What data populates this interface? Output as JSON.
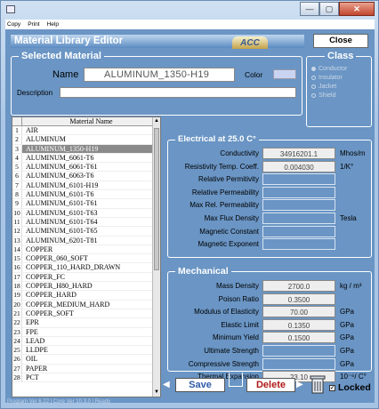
{
  "menu": [
    "Copy",
    "Print",
    "Help"
  ],
  "window_buttons": {
    "minimize": "—",
    "maximize": "▢",
    "close": "✕"
  },
  "header": {
    "title": "Material Library Editor",
    "logo": "ACC",
    "close_label": "Close"
  },
  "selected": {
    "title": "Selected Material",
    "name_label": "Name",
    "name_value": "ALUMINUM_1350-H19",
    "color_label": "Color",
    "color_value": "#c9d4f2",
    "description_label": "Description",
    "description_value": ""
  },
  "class_group": {
    "title": "Class",
    "options": [
      {
        "label": "Conductor",
        "selected": true
      },
      {
        "label": "Insulator",
        "selected": false
      },
      {
        "label": "Jacket",
        "selected": false
      },
      {
        "label": "Shield",
        "selected": false
      }
    ]
  },
  "list": {
    "header": "Material Name",
    "selected_index": 3,
    "items": [
      {
        "n": "1",
        "name": "AIR"
      },
      {
        "n": "2",
        "name": "ALUMINUM"
      },
      {
        "n": "3",
        "name": "ALUMINUM_1350-H19"
      },
      {
        "n": "4",
        "name": "ALUMINUM_6061-T6"
      },
      {
        "n": "5",
        "name": "ALUMINUM_6061-T61"
      },
      {
        "n": "6",
        "name": "ALUMINUM_6063-T6"
      },
      {
        "n": "7",
        "name": "ALUMINUM_6101-H19"
      },
      {
        "n": "8",
        "name": "ALUMINUM_6101-T6"
      },
      {
        "n": "9",
        "name": "ALUMINUM_6101-T61"
      },
      {
        "n": "10",
        "name": "ALUMINUM_6101-T63"
      },
      {
        "n": "11",
        "name": "ALUMINUM_6101-T64"
      },
      {
        "n": "12",
        "name": "ALUMINUM_6101-T65"
      },
      {
        "n": "13",
        "name": "ALUMINUM_6201-T81"
      },
      {
        "n": "14",
        "name": "COPPER"
      },
      {
        "n": "15",
        "name": "COPPER_060_SOFT"
      },
      {
        "n": "16",
        "name": "COPPER_110_HARD_DRAWN"
      },
      {
        "n": "17",
        "name": "COPPER_FC"
      },
      {
        "n": "18",
        "name": "COPPER_H80_HARD"
      },
      {
        "n": "19",
        "name": "COPPER_HARD"
      },
      {
        "n": "20",
        "name": "COPPER_MEDIUM_HARD"
      },
      {
        "n": "21",
        "name": "COPPER_SOFT"
      },
      {
        "n": "22",
        "name": "EPR"
      },
      {
        "n": "23",
        "name": "FPE"
      },
      {
        "n": "24",
        "name": "LEAD"
      },
      {
        "n": "25",
        "name": "LLDPE"
      },
      {
        "n": "26",
        "name": "OIL"
      },
      {
        "n": "27",
        "name": "PAPER"
      },
      {
        "n": "28",
        "name": "PCT"
      }
    ]
  },
  "electrical": {
    "title": "Electrical at 25.0 C°",
    "rows": [
      {
        "label": "Conductivity",
        "value": "34916201.1",
        "unit": "Mhos/m"
      },
      {
        "label": "Resistivity Temp. Coeff.",
        "value": "0.004030",
        "unit": "1/K°"
      },
      {
        "label": "Relative Permitivity",
        "value": "",
        "unit": ""
      },
      {
        "label": "Relative Permeability",
        "value": "",
        "unit": ""
      },
      {
        "label": "Max Rel. Permeability",
        "value": "",
        "unit": ""
      },
      {
        "label": "Max Flux Density",
        "value": "",
        "unit": "Tesla"
      },
      {
        "label": "Magnetic Constant",
        "value": "",
        "unit": ""
      },
      {
        "label": "Magnetic Exponent",
        "value": "",
        "unit": ""
      }
    ]
  },
  "mechanical": {
    "title": "Mechanical",
    "rows": [
      {
        "label": "Mass Density",
        "value": "2700.0",
        "unit": "kg / m³"
      },
      {
        "label": "Poison Ratio",
        "value": "0.3500",
        "unit": ""
      },
      {
        "label": "Modulus of Elasticity",
        "value": "70.00",
        "unit": "GPa"
      },
      {
        "label": "Elastic Limit",
        "value": "0.1350",
        "unit": "GPa"
      },
      {
        "label": "Minimum Yield",
        "value": "0.1500",
        "unit": "GPa"
      },
      {
        "label": "Ultimate Strength",
        "value": "",
        "unit": "GPa"
      },
      {
        "label": "Compressive Strength",
        "value": "",
        "unit": "GPa"
      },
      {
        "label": "Thermal Expansion",
        "value": "23.10",
        "unit": "10⁻⁶/ C°"
      }
    ]
  },
  "actions": {
    "save": "Save",
    "delete": "Delete",
    "locked": "Locked",
    "locked_mark": "✓"
  },
  "status": "Program Ver 6.22 | Core Ver 10.3.0 | Ready"
}
